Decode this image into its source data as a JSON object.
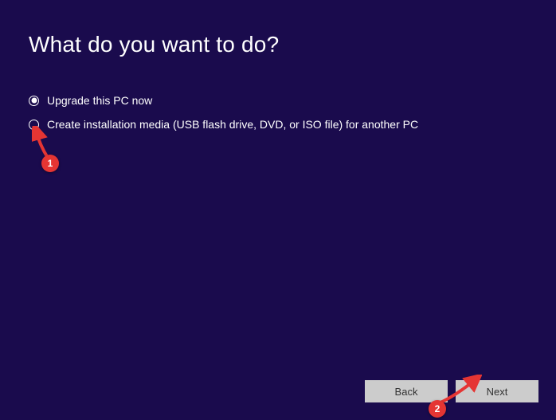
{
  "heading": "What do you want to do?",
  "options": [
    {
      "label": "Upgrade this PC now",
      "selected": true
    },
    {
      "label": "Create installation media (USB flash drive, DVD, or ISO file) for another PC",
      "selected": false
    }
  ],
  "buttons": {
    "back": "Back",
    "next": "Next"
  },
  "annotations": {
    "step1": "1",
    "step2": "2"
  }
}
